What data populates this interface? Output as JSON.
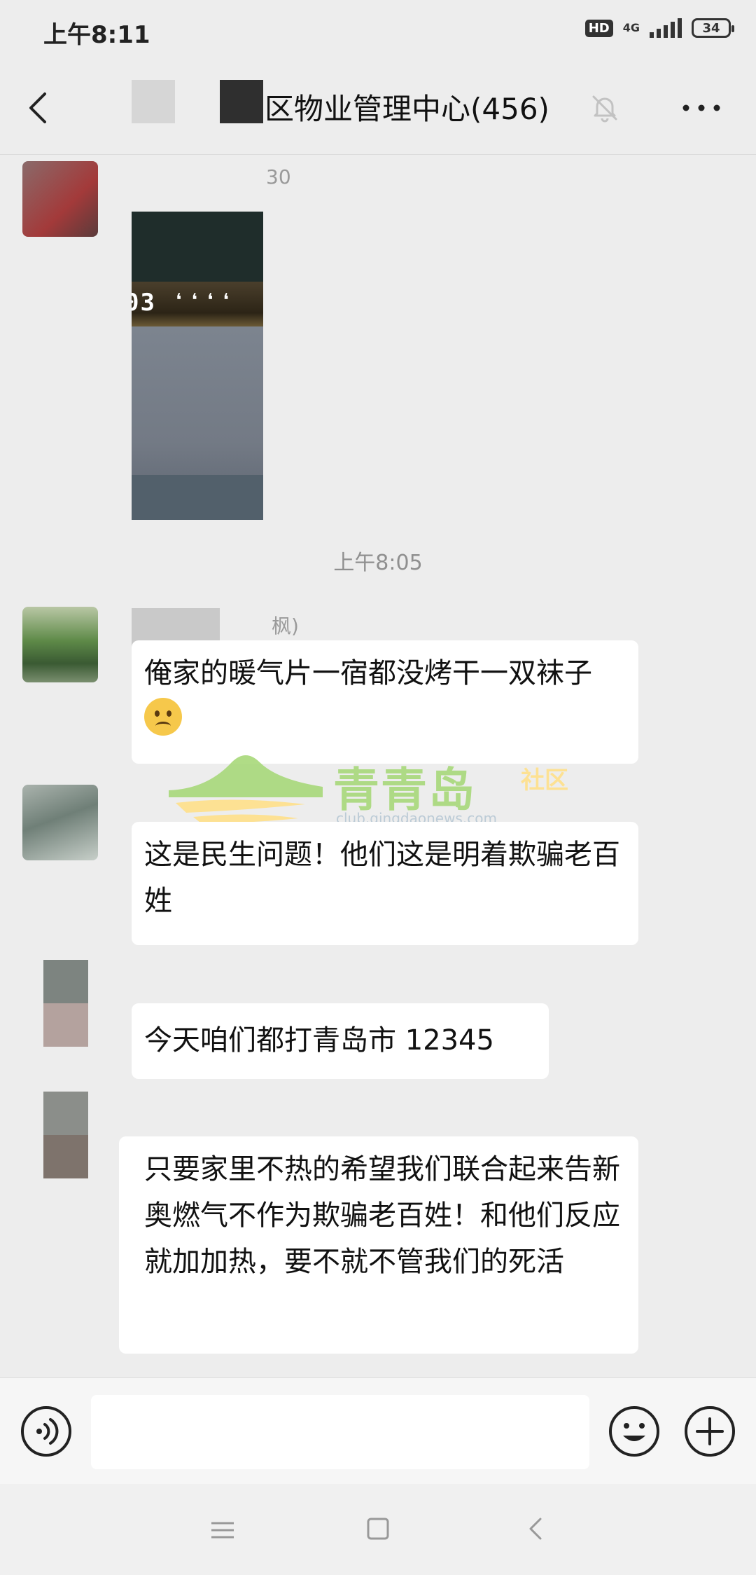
{
  "status_bar": {
    "time": "上午8:11",
    "hd_label": "HD",
    "network_label": "4G",
    "battery_level": "34"
  },
  "header": {
    "title": "区物业管理中心(456)"
  },
  "messages": {
    "msg1": {
      "sender_fragment": "30"
    },
    "timestamp": "上午8:05",
    "msg2": {
      "sender_fragment": "枫)",
      "text": "俺家的暖气片一宿都没烤干一双袜子"
    },
    "msg3": {
      "text": "这是民生问题！他们这是明着欺骗老百姓"
    },
    "msg4": {
      "text": "今天咱们都打青岛市 12345"
    },
    "msg5": {
      "text": "只要家里不热的希望我们联合起来告新奥燃气不作为欺骗老百姓！和他们反应就加加热，要不就不管我们的死活"
    }
  },
  "watermark": {
    "main": "青青岛",
    "sub": "社区",
    "url": "club.qingdaonews.com"
  },
  "colors": {
    "background": "#ededed",
    "bubble": "#ffffff",
    "watermark_green": "#a8d97a",
    "watermark_yellow": "#ffe08a"
  }
}
